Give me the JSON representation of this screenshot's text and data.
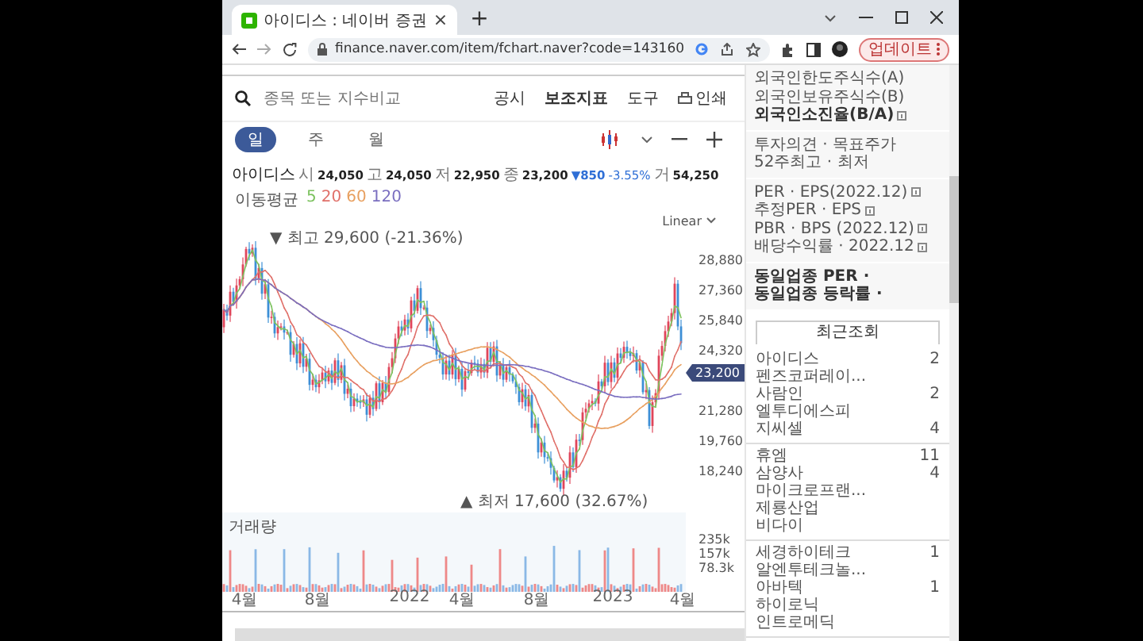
{
  "browser": {
    "tab_title": "아이디스 : 네이버 증권",
    "tab_close": "×",
    "new_tab": "+",
    "url": "finance.naver.com/item/fchart.naver?code=143160",
    "update_button": "업데이트"
  },
  "toolbar": {
    "search_placeholder": "종목 또는 지수비교",
    "links": [
      {
        "label": "공시",
        "bold": false
      },
      {
        "label": "보조지표",
        "bold": true
      },
      {
        "label": "도구",
        "bold": false
      }
    ],
    "print": "인쇄"
  },
  "periods": [
    {
      "label": "일",
      "selected": true
    },
    {
      "label": "주",
      "selected": false
    },
    {
      "label": "월",
      "selected": false
    }
  ],
  "quote": {
    "name": "아이디스",
    "fields": [
      {
        "label": "시",
        "value": "24,050"
      },
      {
        "label": "고",
        "value": "24,050"
      },
      {
        "label": "저",
        "value": "22,950"
      },
      {
        "label": "종",
        "value": "23,200"
      }
    ],
    "change": "▼850",
    "change_pct": "-3.55%",
    "volume_label": "거",
    "volume": "54,250"
  },
  "moving_average": {
    "label": "이동평균",
    "periods": [
      {
        "label": "5",
        "color": "#7cc25f"
      },
      {
        "label": "20",
        "color": "#e0706a"
      },
      {
        "label": "60",
        "color": "#e8a060"
      },
      {
        "label": "120",
        "color": "#7b6fc0"
      }
    ]
  },
  "scale": "Linear",
  "price_chart": {
    "high_note": "▼ 최고 29,600 (-21.36%)",
    "low_note": "▲ 최저 17,600 (32.67%)",
    "yticks": [
      "28,880",
      "27,360",
      "25,840",
      "24,320",
      "21,280",
      "19,760",
      "18,240"
    ],
    "current": "23,200"
  },
  "volume_chart": {
    "title": "거래량",
    "yticks": [
      "235k",
      "157k",
      "78.3k"
    ]
  },
  "xlabels": [
    "4월",
    "8월",
    "2022",
    "4월",
    "8월",
    "2023",
    "4월"
  ],
  "side": {
    "info_groups": [
      [
        {
          "label": "외국인한도주식수(A)",
          "bold": false,
          "info_icon": false
        },
        {
          "label": "외국인보유주식수(B)",
          "bold": false,
          "info_icon": false
        },
        {
          "label": "외국인소진율(B/A)",
          "bold": true,
          "info_icon": true
        }
      ],
      [
        {
          "label": "투자의견 · 목표주가",
          "bold": false,
          "info_icon": false
        },
        {
          "label": "52주최고 · 최저",
          "bold": false,
          "info_icon": false
        }
      ],
      [
        {
          "label": "PER · EPS(2022.12)",
          "bold": false,
          "info_icon": true
        },
        {
          "label": "추정PER · EPS",
          "bold": false,
          "info_icon": true
        },
        {
          "label": "PBR · BPS (2022.12)",
          "bold": false,
          "info_icon": true
        },
        {
          "label": "배당수익률 · 2022.12",
          "bold": false,
          "info_icon": true
        }
      ],
      [
        {
          "label": "동일업종 PER ·",
          "bold": true,
          "info_icon": false
        },
        {
          "label": "동일업종 등락률 ·",
          "bold": true,
          "info_icon": false
        }
      ]
    ],
    "recent_title": "최근조회",
    "recent_groups": [
      [
        {
          "name": "아이디스",
          "count": "2"
        },
        {
          "name": "펜즈코퍼레이..."
        },
        {
          "name": "사람인",
          "count": "2"
        },
        {
          "name": "엘투디에스피"
        },
        {
          "name": "지씨셀",
          "count": "4"
        }
      ],
      [
        {
          "name": "휴엠",
          "count": "11"
        },
        {
          "name": "삼양사",
          "count": "4"
        },
        {
          "name": "마이크로프랜..."
        },
        {
          "name": "제룡산업"
        },
        {
          "name": "비다이"
        }
      ],
      [
        {
          "name": "세경하이테크",
          "count": "1"
        },
        {
          "name": "알엔투테크놀..."
        },
        {
          "name": "아바텍",
          "count": "1"
        },
        {
          "name": "하이로닉"
        },
        {
          "name": "인트로메딕"
        }
      ]
    ]
  }
}
